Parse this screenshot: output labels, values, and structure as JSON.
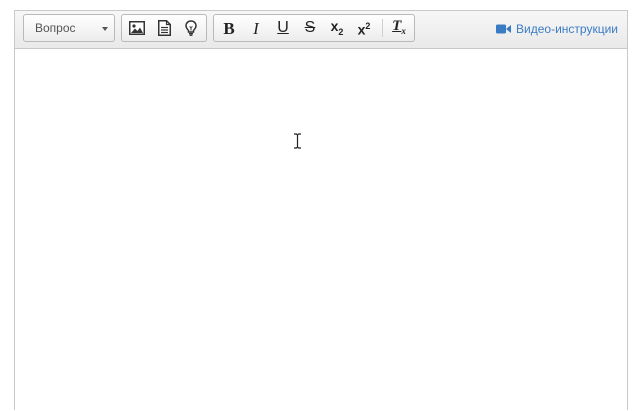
{
  "toolbar": {
    "format_select": {
      "value": "Вопрос"
    },
    "insert_buttons": [
      {
        "icon": "image-icon"
      },
      {
        "icon": "document-icon"
      },
      {
        "icon": "lightbulb-icon"
      }
    ],
    "style_buttons": [
      {
        "icon": "bold-icon",
        "glyph": "B"
      },
      {
        "icon": "italic-icon",
        "glyph": "I"
      },
      {
        "icon": "underline-icon",
        "glyph": "U"
      },
      {
        "icon": "strikethrough-icon",
        "glyph": "S"
      },
      {
        "icon": "subscript-icon",
        "glyph": "x",
        "small": "2"
      },
      {
        "icon": "superscript-icon",
        "glyph": "x",
        "small": "2"
      },
      {
        "icon": "remove-format-icon",
        "glyph": "T",
        "small": "x"
      }
    ],
    "video_link": {
      "label": "Видео-инструкции",
      "icon": "video-camera-icon",
      "color": "#3a7cc4"
    }
  },
  "editor": {
    "content": ""
  }
}
